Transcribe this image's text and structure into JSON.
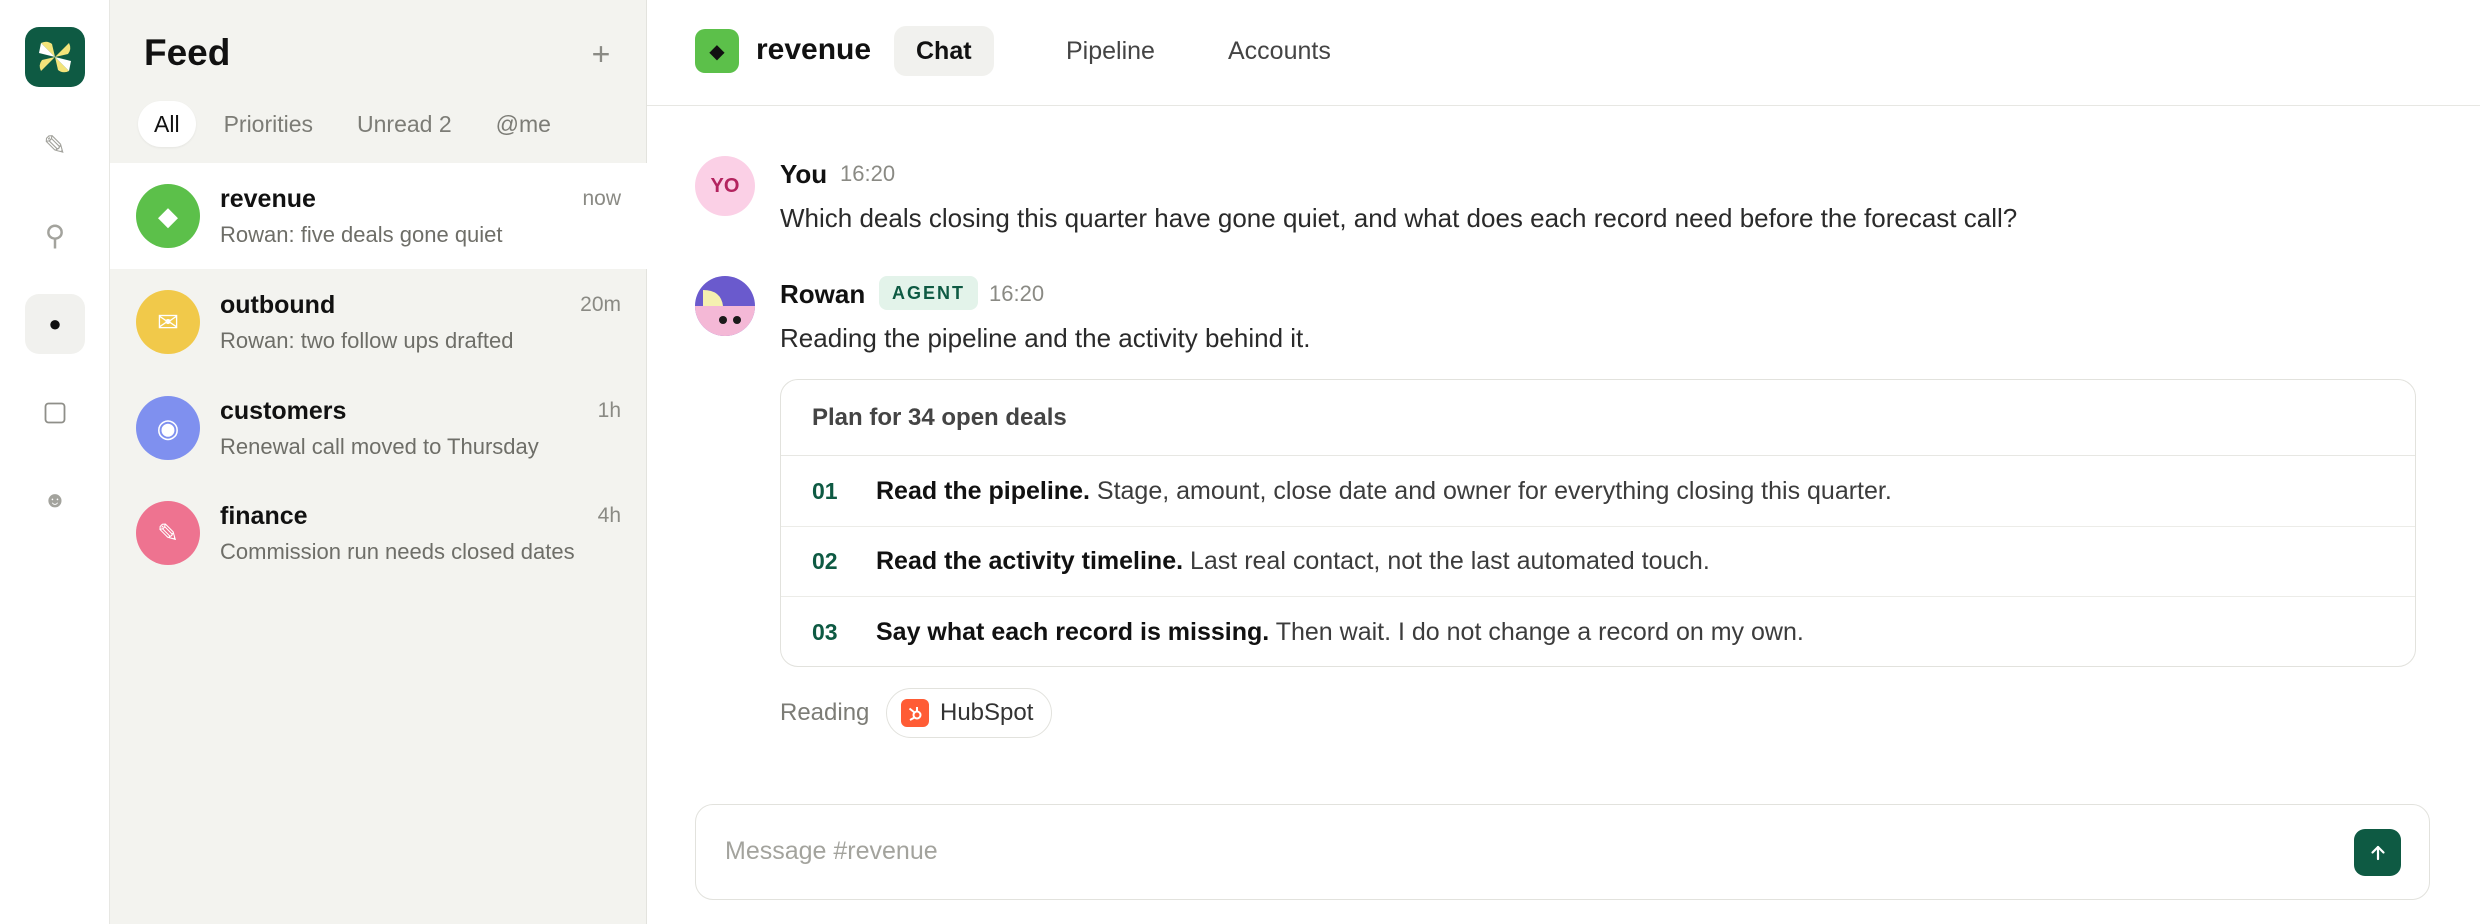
{
  "rail": {
    "icons": [
      "logo-icon",
      "pencil-icon",
      "pin-icon",
      "dot-icon",
      "square-icon",
      "smiley-icon"
    ],
    "accent": "#0e5a43"
  },
  "feed": {
    "title": "Feed",
    "add_label": "+",
    "filters": [
      "All",
      "Priorities",
      "Unread 2",
      "@me"
    ],
    "items": [
      {
        "name": "revenue",
        "time": "now",
        "preview": "Rowan: five deals gone quiet",
        "color": "#5cc04a",
        "icon": "diamond-icon"
      },
      {
        "name": "outbound",
        "time": "20m",
        "preview": "Rowan: two follow ups drafted",
        "color": "#f1c94a",
        "icon": "envelope-icon"
      },
      {
        "name": "customers",
        "time": "1h",
        "preview": "Renewal call moved to Thursday",
        "color": "#7f90ef",
        "icon": "target-icon"
      },
      {
        "name": "finance",
        "time": "4h",
        "preview": "Commission run needs closed dates",
        "color": "#ee7390",
        "icon": "pencil-icon"
      }
    ]
  },
  "header": {
    "channel": "revenue",
    "tabs": [
      "Chat",
      "Pipeline",
      "Accounts"
    ]
  },
  "messages": [
    {
      "initials": "YO",
      "author": "You",
      "time": "16:20",
      "text": "Which deals closing this quarter have gone quiet, and what does each record need before the forecast call?"
    },
    {
      "author": "Rowan",
      "badge": "AGENT",
      "time": "16:20",
      "text": "Reading the pipeline and the activity behind it."
    }
  ],
  "plan": {
    "title": "Plan for 34 open deals",
    "steps": [
      {
        "num": "01",
        "bold": "Read the pipeline.",
        "rest": "Stage, amount, close date and owner for everything closing this quarter."
      },
      {
        "num": "02",
        "bold": "Read the activity timeline.",
        "rest": "Last real contact, not the last automated touch."
      },
      {
        "num": "03",
        "bold": "Say what each record is missing.",
        "rest": "Then wait. I do not change a record on my own."
      }
    ]
  },
  "reading": {
    "label": "Reading",
    "source": "HubSpot"
  },
  "composer": {
    "placeholder": "Message #revenue"
  }
}
